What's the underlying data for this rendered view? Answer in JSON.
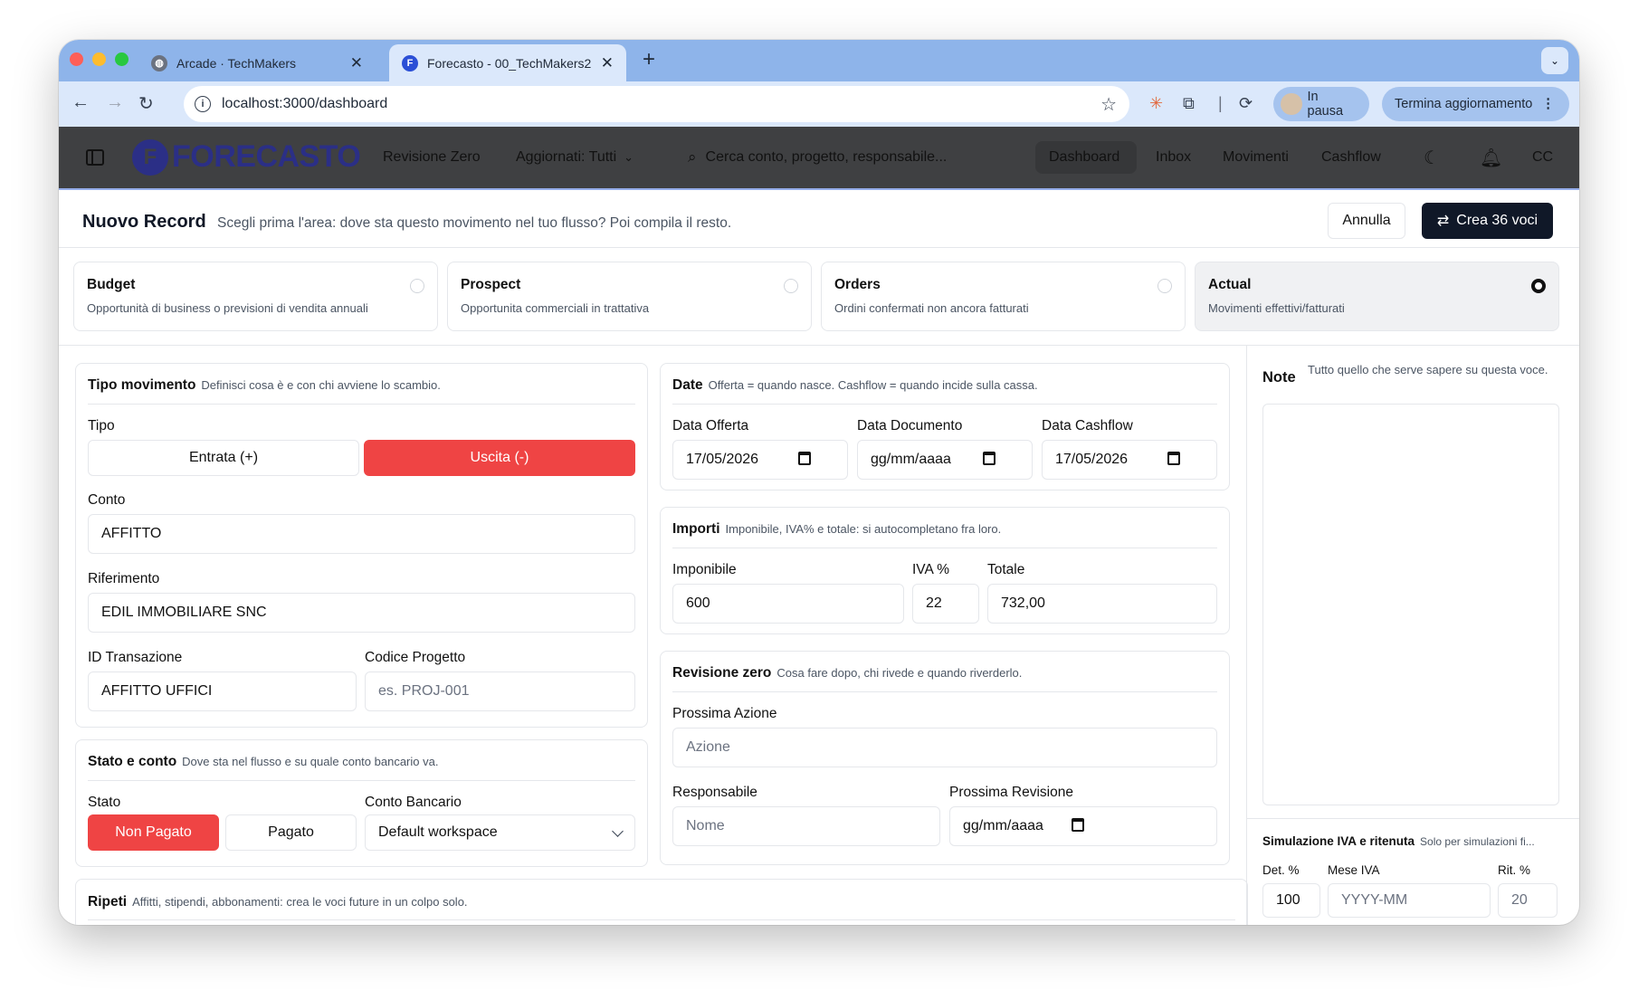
{
  "browser": {
    "tabs": [
      {
        "title": "Arcade · TechMakers"
      },
      {
        "title": "Forecasto - 00_TechMakers2"
      }
    ],
    "url": "localhost:3000/dashboard",
    "profile_label": "In pausa",
    "update_label": "Termina aggiornamento"
  },
  "app": {
    "logo_text": "FORECASTO",
    "workspace": "Revisione Zero",
    "filter": "Aggiornati: Tutti",
    "search_placeholder": "Cerca conto, progetto, responsabile...",
    "nav": [
      "Dashboard",
      "Inbox",
      "Movimenti",
      "Cashflow"
    ],
    "user_initials": "CC"
  },
  "form": {
    "title": "Nuovo Record",
    "subtitle": "Scegli prima l'area: dove sta questo movimento nel tuo flusso? Poi compila il resto.",
    "cancel_label": "Annulla",
    "create_label": "Crea 36 voci",
    "areas": [
      {
        "title": "Budget",
        "desc": "Opportunità di business o previsioni di vendita annuali"
      },
      {
        "title": "Prospect",
        "desc": "Opportunita commerciali in trattativa"
      },
      {
        "title": "Orders",
        "desc": "Ordini confermati non ancora fatturati"
      },
      {
        "title": "Actual",
        "desc": "Movimenti effettivi/fatturati"
      }
    ],
    "tipo": {
      "title": "Tipo movimento",
      "desc": "Definisci cosa è e con chi avviene lo scambio.",
      "tipo_label": "Tipo",
      "entrata": "Entrata (+)",
      "uscita": "Uscita (-)",
      "conto_label": "Conto",
      "conto_value": "AFFITTO",
      "riferimento_label": "Riferimento",
      "riferimento_value": "EDIL IMMOBILIARE SNC",
      "id_label": "ID Transazione",
      "id_value": "AFFITTO UFFICI",
      "codice_label": "Codice Progetto",
      "codice_placeholder": "es. PROJ-001"
    },
    "stato": {
      "title": "Stato e conto",
      "desc": "Dove sta nel flusso e su quale conto bancario va.",
      "stato_label": "Stato",
      "non_pagato": "Non Pagato",
      "pagato": "Pagato",
      "conto_label": "Conto Bancario",
      "conto_value": "Default workspace"
    },
    "ripeti": {
      "title": "Ripeti",
      "desc": "Affitti, stipendi, abbonamenti: crea le voci future in un colpo solo."
    },
    "date": {
      "title": "Date",
      "desc": "Offerta = quando nasce. Cashflow = quando incide sulla cassa.",
      "offerta_label": "Data Offerta",
      "offerta_value": "17/05/2026",
      "documento_label": "Data Documento",
      "documento_value": "gg/mm/aaaa",
      "cashflow_label": "Data Cashflow",
      "cashflow_value": "17/05/2026"
    },
    "importi": {
      "title": "Importi",
      "desc": "Imponibile, IVA% e totale: si autocompletano fra loro.",
      "imponibile_label": "Imponibile",
      "imponibile_value": "600",
      "iva_label": "IVA %",
      "iva_value": "22",
      "totale_label": "Totale",
      "totale_value": "732,00"
    },
    "revisione": {
      "title": "Revisione zero",
      "desc": "Cosa fare dopo, chi rivede e quando riverderlo.",
      "azione_label": "Prossima Azione",
      "azione_placeholder": "Azione",
      "resp_label": "Responsabile",
      "resp_placeholder": "Nome",
      "rev_label": "Prossima Revisione",
      "rev_value": "gg/mm/aaaa"
    },
    "note": {
      "title": "Note",
      "desc": "Tutto quello che serve sapere su questa voce."
    },
    "sim": {
      "title": "Simulazione IVA e ritenuta",
      "desc": "Solo per simulazioni fi...",
      "det_label": "Det. %",
      "det_value": "100",
      "mese_label": "Mese IVA",
      "mese_placeholder": "YYYY-MM",
      "rit_label": "Rit. %",
      "rit_value": "20"
    }
  }
}
